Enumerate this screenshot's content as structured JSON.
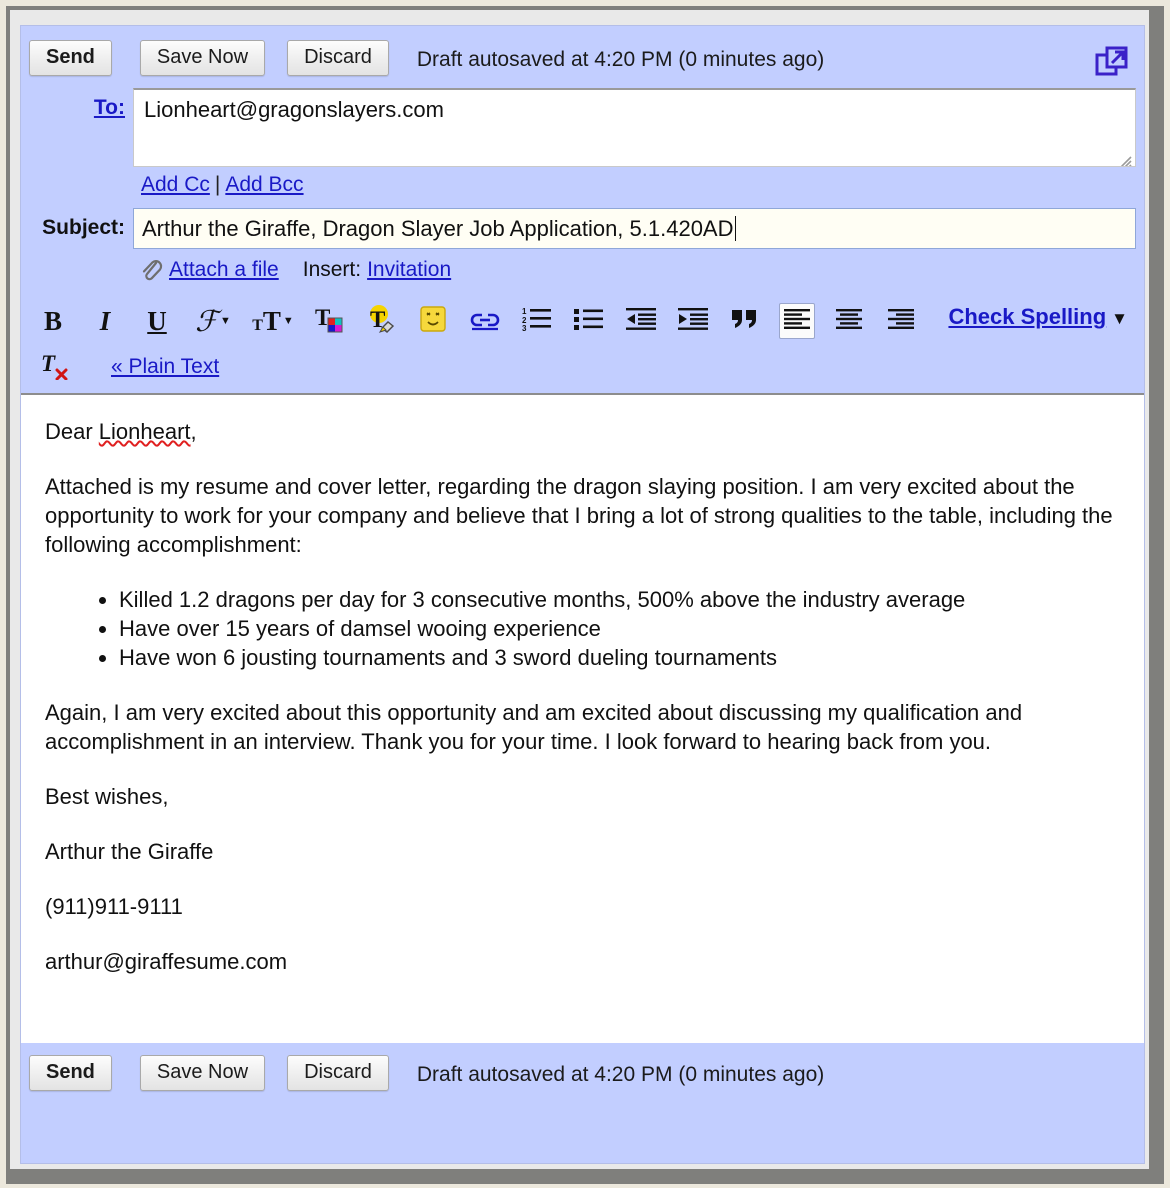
{
  "window": {
    "popout_icon": "popout-window-icon"
  },
  "toolbar_top": {
    "send_label": "Send",
    "save_label": "Save Now",
    "discard_label": "Discard",
    "autosave_status": "Draft autosaved at 4:20 PM (0 minutes ago)"
  },
  "compose": {
    "to_label": "To:",
    "to_value": "Lionheart@gragonslayers.com",
    "add_cc_label": "Add Cc",
    "cc_separator": "|",
    "add_bcc_label": "Add Bcc",
    "subject_label": "Subject:",
    "subject_value": "Arthur the Giraffe, Dragon Slayer Job Application, 5.1.420AD",
    "attach_label": "Attach a file",
    "insert_label": "Insert:",
    "insert_option": "Invitation"
  },
  "format_toolbar": {
    "buttons": [
      {
        "name": "bold-button",
        "icon": "bold-icon",
        "glyph": "B"
      },
      {
        "name": "italic-button",
        "icon": "italic-icon",
        "glyph": "I"
      },
      {
        "name": "underline-button",
        "icon": "underline-icon",
        "glyph": "U"
      },
      {
        "name": "font-family-button",
        "icon": "font-family-icon",
        "glyph": "F"
      },
      {
        "name": "font-size-button",
        "icon": "font-size-icon",
        "glyph": "TT"
      },
      {
        "name": "text-color-button",
        "icon": "text-color-icon",
        "glyph": "T"
      },
      {
        "name": "highlight-color-button",
        "icon": "highlight-icon",
        "glyph": "T"
      },
      {
        "name": "emoji-button",
        "icon": "smiley-icon",
        "glyph": ""
      },
      {
        "name": "insert-link-button",
        "icon": "link-chain-icon",
        "glyph": ""
      },
      {
        "name": "numbered-list-button",
        "icon": "numbered-list-icon",
        "glyph": ""
      },
      {
        "name": "bulleted-list-button",
        "icon": "bulleted-list-icon",
        "glyph": ""
      },
      {
        "name": "outdent-button",
        "icon": "outdent-icon",
        "glyph": ""
      },
      {
        "name": "indent-button",
        "icon": "indent-icon",
        "glyph": ""
      },
      {
        "name": "blockquote-button",
        "icon": "quote-icon",
        "glyph": ""
      },
      {
        "name": "align-left-button",
        "icon": "align-left-icon",
        "glyph": ""
      },
      {
        "name": "align-center-button",
        "icon": "align-center-icon",
        "glyph": ""
      },
      {
        "name": "align-right-button",
        "icon": "align-right-icon",
        "glyph": ""
      }
    ],
    "active_button": "align-left-button",
    "remove_formatting_icon": "remove-formatting-icon",
    "check_spelling_label": "Check Spelling",
    "check_spelling_arrow": "▼",
    "plain_text_label": "« Plain Text"
  },
  "body": {
    "greeting_prefix": "Dear ",
    "greeting_name": "Lionheart",
    "greeting_suffix": ",",
    "paragraph1": "Attached is my resume and cover letter, regarding the dragon slaying position.  I am very excited about the opportunity to work for your company and believe that I bring a lot of strong qualities to the table, including the following accomplishment:",
    "bullets": [
      "Killed 1.2 dragons per day for 3 consecutive months, 500% above the industry average",
      "Have over 15 years of damsel wooing experience",
      "Have won 6 jousting tournaments and 3 sword dueling tournaments"
    ],
    "paragraph2": "Again, I am very excited about this opportunity and am excited about discussing my qualification and accomplishment in an interview.  Thank you for your time.  I look forward to hearing back from you.",
    "signature": [
      "Best wishes,",
      "Arthur the Giraffe",
      "(911)911-9111",
      "arthur@giraffesume.com"
    ]
  },
  "toolbar_bottom": {
    "send_label": "Send",
    "save_label": "Save Now",
    "discard_label": "Discard",
    "autosave_status": "Draft autosaved at 4:20 PM (0 minutes ago)"
  },
  "colors": {
    "compose_background": "#c2ceff",
    "link": "#1919c6",
    "spellcheck_underline": "#e02020",
    "subject_field": "#fffef4",
    "body_background": "#ffffff"
  }
}
